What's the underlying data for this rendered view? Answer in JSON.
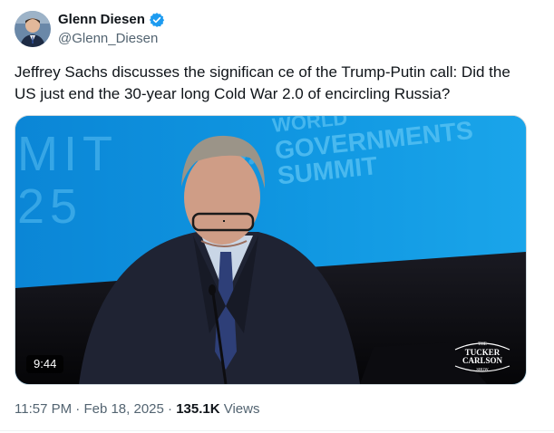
{
  "author": {
    "name": "Glenn Diesen",
    "handle": "@Glenn_Diesen",
    "verified_icon": "verified-badge-icon",
    "verified_color": "#1d9bf0"
  },
  "tweet": {
    "text": "Jeffrey Sachs discusses the significan ce of the Trump-Putin call: Did the US just end the 30-year long Cold War 2.0 of encircling Russia?"
  },
  "media": {
    "duration": "9:44",
    "backdrop_text": {
      "left_line1": "MIT",
      "left_line2": "25",
      "right_line1": "WORLD",
      "right_line2": "GOVERNMENTS",
      "right_line3": "SUMMIT"
    },
    "watermark": {
      "line1": "THE",
      "line2": "TUCKER",
      "line3": "CARLSON",
      "line4": "SHOW"
    }
  },
  "meta": {
    "time": "11:57 PM",
    "date": "Feb 18, 2025",
    "separator": "·",
    "views_count": "135.1K",
    "views_label": "Views"
  }
}
